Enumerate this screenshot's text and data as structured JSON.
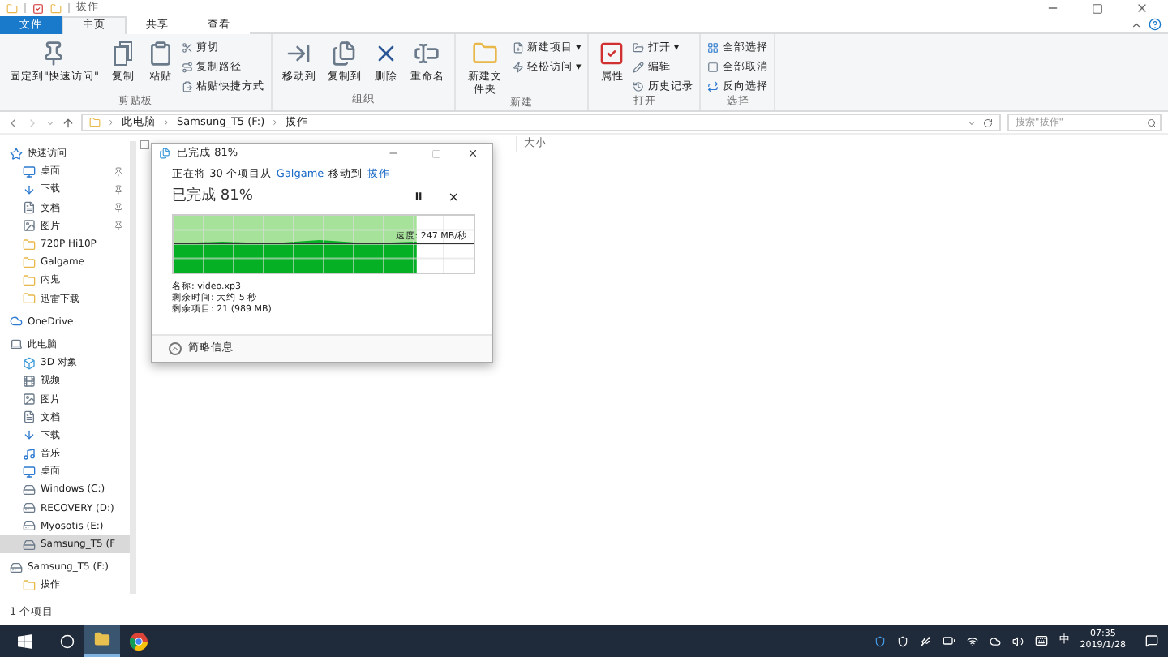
{
  "window": {
    "title": "拔作"
  },
  "tabs": [
    {
      "label": "文件",
      "kind": "file",
      "selected": false
    },
    {
      "label": "主页",
      "kind": "tab",
      "selected": true
    },
    {
      "label": "共享",
      "kind": "tab",
      "selected": false
    },
    {
      "label": "查看",
      "kind": "tab",
      "selected": false
    }
  ],
  "ribbon": [
    {
      "name": "剪贴板",
      "big": [
        {
          "label": "固定到\"快速访问\""
        },
        {
          "label": "复制"
        },
        {
          "label": "粘贴"
        }
      ],
      "small": [
        {
          "label": "剪切"
        },
        {
          "label": "复制路径"
        },
        {
          "label": "粘贴快捷方式"
        }
      ]
    },
    {
      "name": "组织",
      "big": [
        {
          "label": "移动到"
        },
        {
          "label": "复制到"
        },
        {
          "label": "删除"
        },
        {
          "label": "重命名"
        }
      ]
    },
    {
      "name": "新建",
      "big": [
        {
          "label": "新建文件夹"
        }
      ],
      "small": [
        {
          "label": "新建项目 ▾"
        },
        {
          "label": "轻松访问 ▾"
        }
      ]
    },
    {
      "name": "打开",
      "big": [
        {
          "label": "属性"
        }
      ],
      "small": [
        {
          "label": "打开 ▾"
        },
        {
          "label": "编辑"
        },
        {
          "label": "历史记录"
        }
      ]
    },
    {
      "name": "选择",
      "small": [
        {
          "label": "全部选择"
        },
        {
          "label": "全部取消"
        },
        {
          "label": "反向选择"
        }
      ]
    }
  ],
  "address": {
    "crumbs": [
      "此电脑",
      "Samsung_T5 (F:)",
      "拔作"
    ],
    "search_placeholder": "搜索\"拔作\""
  },
  "sidebar": {
    "items": [
      {
        "label": "快速访问",
        "kind": "star",
        "selected": false,
        "children": [
          {
            "label": "桌面",
            "kind": "desktop",
            "pinned": true,
            "selected": false
          },
          {
            "label": "下载",
            "kind": "download",
            "pinned": true,
            "selected": false
          },
          {
            "label": "文档",
            "kind": "doc",
            "pinned": true,
            "selected": false
          },
          {
            "label": "图片",
            "kind": "image",
            "pinned": true,
            "selected": false
          },
          {
            "label": "720P Hi10P",
            "kind": "folder",
            "pinned": false,
            "selected": false
          },
          {
            "label": "Galgame",
            "kind": "folder",
            "pinned": false,
            "selected": false
          },
          {
            "label": "内鬼",
            "kind": "folder",
            "pinned": false,
            "selected": false
          },
          {
            "label": "迅雷下载",
            "kind": "folder",
            "pinned": false,
            "selected": false
          }
        ]
      },
      {
        "label": "OneDrive",
        "kind": "cloud",
        "selected": false
      },
      {
        "label": "此电脑",
        "kind": "pc",
        "selected": false,
        "children": [
          {
            "label": "3D 对象",
            "kind": "cube",
            "selected": false
          },
          {
            "label": "视频",
            "kind": "video",
            "selected": false
          },
          {
            "label": "图片",
            "kind": "image",
            "selected": false
          },
          {
            "label": "文档",
            "kind": "doc",
            "selected": false
          },
          {
            "label": "下载",
            "kind": "download",
            "selected": false
          },
          {
            "label": "音乐",
            "kind": "music",
            "selected": false
          },
          {
            "label": "桌面",
            "kind": "desktop",
            "selected": false
          },
          {
            "label": "Windows (C:)",
            "kind": "drive",
            "selected": false
          },
          {
            "label": "RECOVERY (D:)",
            "kind": "drive",
            "selected": false
          },
          {
            "label": "Myosotis (E:)",
            "kind": "drive",
            "selected": false
          },
          {
            "label": "Samsung_T5 (F",
            "kind": "drive",
            "selected": true
          }
        ]
      },
      {
        "label": "Samsung_T5 (F:)",
        "kind": "drive",
        "selected": false,
        "children": [
          {
            "label": "拔作",
            "kind": "folder",
            "selected": false
          }
        ]
      }
    ]
  },
  "select_all": {
    "checked": false
  },
  "columns": [
    "大小"
  ],
  "dialog": {
    "title": "已完成 81%",
    "line_prefix": "正在将 30 个项目从",
    "source": "Galgame",
    "line_middle": "移动到",
    "target": "拔作",
    "heading": "已完成 81%",
    "pause": "II",
    "cancel": "×",
    "level": 0.81,
    "speed": "速度: 247 MB/秒",
    "details": [
      "名称: video.xp3",
      "剩余时间: 大约 5 秒",
      "剩余项目: 21 (989 MB)"
    ],
    "toggle": "简略信息"
  },
  "status_bar": "1 个项目",
  "taskbar": {
    "ime": "中",
    "time": "07:35",
    "date": "2019/1/28"
  }
}
